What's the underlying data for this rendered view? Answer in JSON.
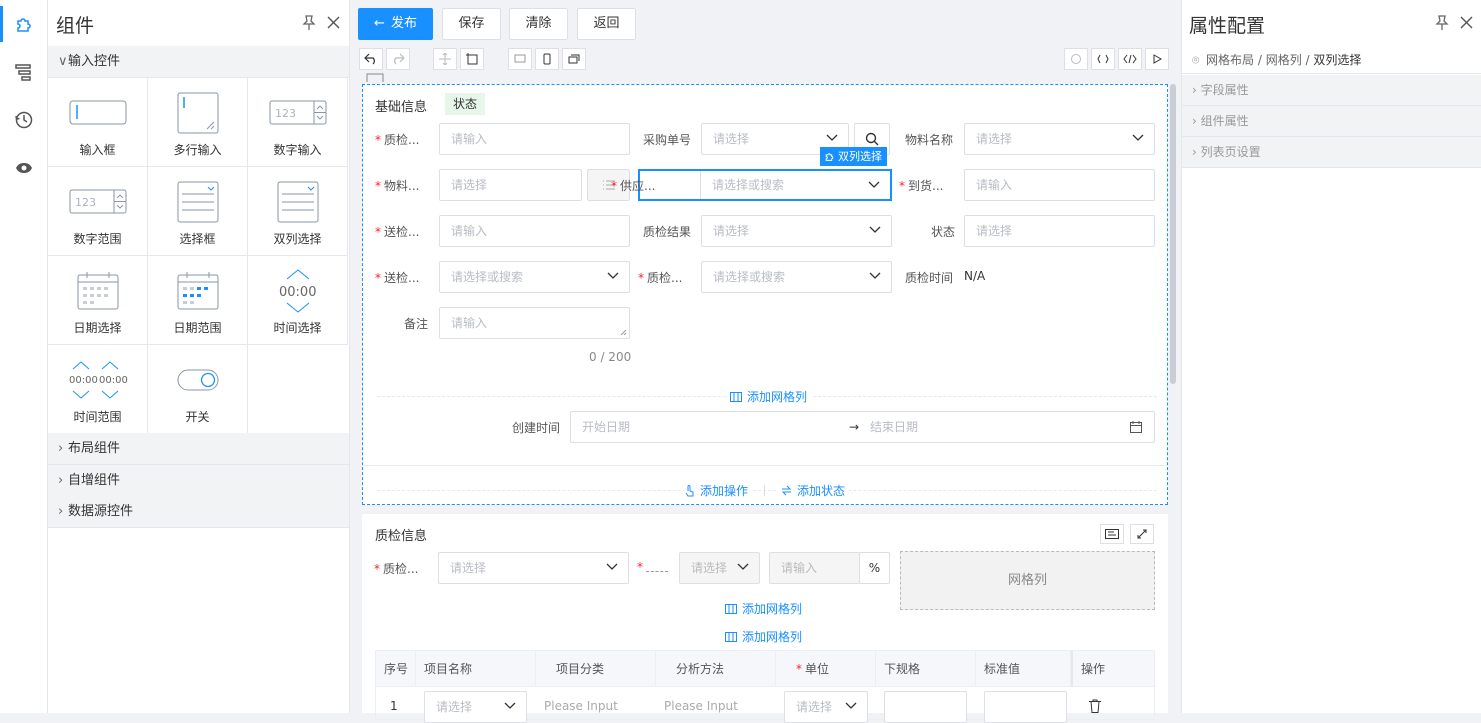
{
  "left_panel": {
    "title": "组件",
    "groups": {
      "input": "输入控件",
      "layout": "布局组件",
      "custom": "自增组件",
      "datasource": "数据源控件"
    },
    "components": [
      "输入框",
      "多行输入",
      "数字输入",
      "数字范围",
      "选择框",
      "双列选择",
      "日期选择",
      "日期范围",
      "时间选择",
      "时间范围",
      "开关"
    ],
    "icon_texts": {
      "num": "123",
      "time": "00:00"
    }
  },
  "toolbar": {
    "publish": "发布",
    "save": "保存",
    "clear": "清除",
    "back": "返回"
  },
  "form": {
    "section_title": "基础信息",
    "status_tag": "状态",
    "f1_label": "质检...",
    "f1_ph": "请输入",
    "f2_label": "采购单号",
    "f2_ph": "请选择",
    "f3_label": "物料名称",
    "f3_ph": "请选择",
    "f4_label": "物料...",
    "f4_ph": "请选择",
    "f5_label": "供应...",
    "f5_ph": "请选择或搜索",
    "f5_badge": "双列选择",
    "f6_label": "到货...",
    "f6_ph": "请输入",
    "f7_label": "送检...",
    "f7_ph": "请输入",
    "f8_label": "质检结果",
    "f8_ph": "请选择",
    "f9_label": "状态",
    "f9_ph": "请选择",
    "f10_label": "送检...",
    "f10_ph": "请选择或搜索",
    "f11_label": "质检...",
    "f11_ph": "请选择或搜索",
    "f12_label": "质检时间",
    "f12_value": "N/A",
    "remark_label": "备注",
    "remark_ph": "请输入",
    "counter": "0 / 200",
    "add_grid_col": "添加网格列",
    "created_label": "创建时间",
    "start_date": "开始日期",
    "end_date": "结束日期",
    "add_action": "添加操作",
    "add_status": "添加状态"
  },
  "qc": {
    "title": "质检信息",
    "q1_label": "质检...",
    "q1_ph": "请选择",
    "q2_ph": "请选择",
    "q3_ph": "请输入",
    "percent": "%",
    "grid_col": "网格列",
    "add_grid_col1": "添加网格列",
    "add_grid_col2": "添加网格列",
    "table_headers": [
      "序号",
      "项目名称",
      "项目分类",
      "分析方法",
      "单位",
      "下规格",
      "标准值",
      "操作"
    ],
    "row1": {
      "index": "1",
      "name_ph": "请选择",
      "category_ph": "Please Input",
      "method_ph": "Please Input",
      "unit_ph": "请选择"
    }
  },
  "right_panel": {
    "title": "属性配置",
    "breadcrumb": [
      "网格布局",
      "网格列",
      "双列选择"
    ],
    "sections": [
      "字段属性",
      "组件属性",
      "列表页设置"
    ]
  },
  "colors": {
    "accent": "#1890ff",
    "required": "#f5222d",
    "status_tag_bg": "#e8f5e9"
  }
}
